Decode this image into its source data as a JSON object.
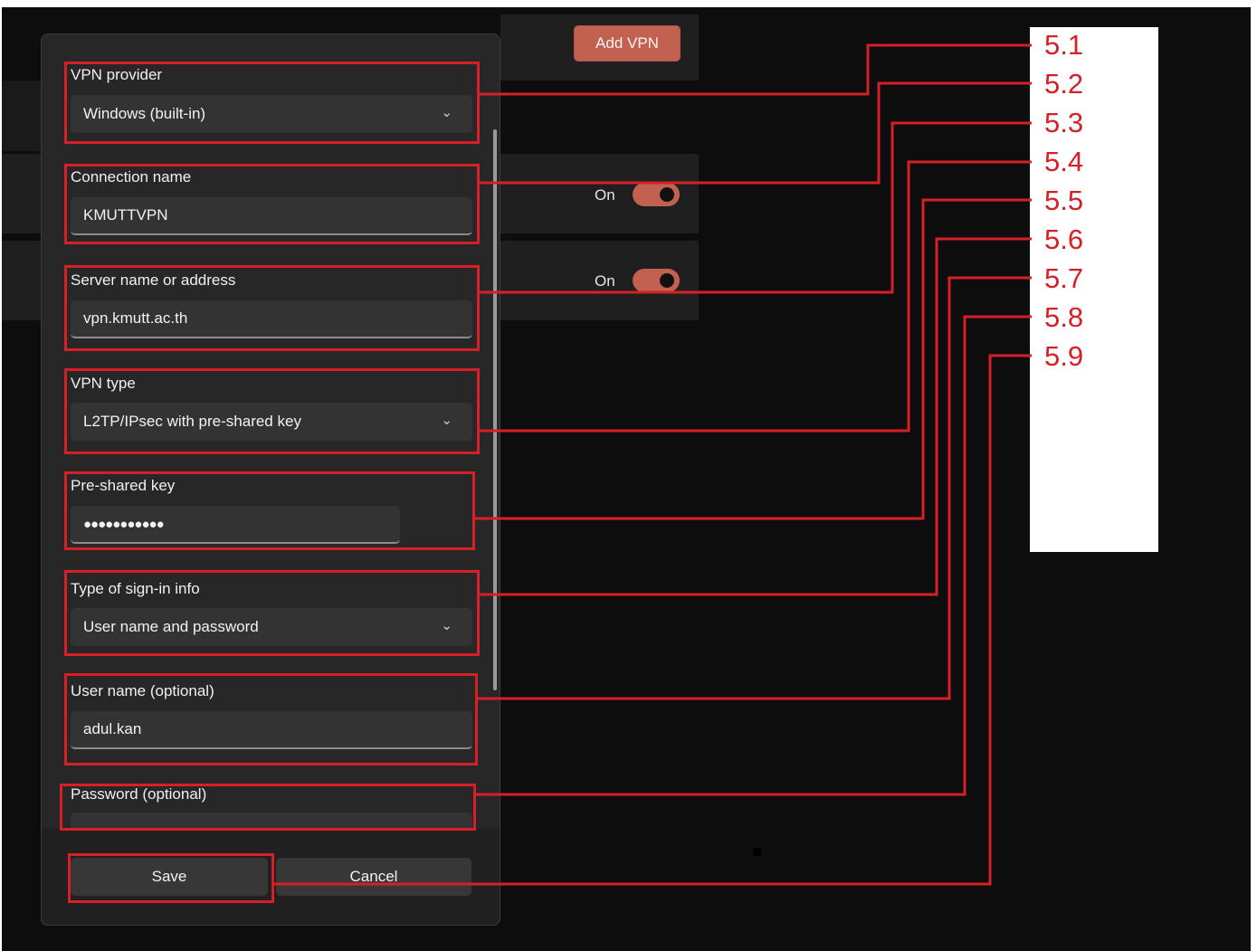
{
  "background": {
    "add_vpn_label": "Add VPN",
    "rows": [
      {
        "state_label": "On"
      },
      {
        "state_label": "On"
      }
    ]
  },
  "dialog": {
    "fields": [
      {
        "label": "VPN provider",
        "value": "Windows (built-in)",
        "kind": "dropdown"
      },
      {
        "label": "Connection name",
        "value": "KMUTTVPN",
        "kind": "text"
      },
      {
        "label": "Server name or address",
        "value": "vpn.kmutt.ac.th",
        "kind": "text"
      },
      {
        "label": "VPN type",
        "value": "L2TP/IPsec with pre-shared key",
        "kind": "dropdown"
      },
      {
        "label": "Pre-shared key",
        "value": "●●●●●●●●●●●",
        "kind": "password"
      },
      {
        "label": "Type of sign-in info",
        "value": "User name and password",
        "kind": "dropdown"
      },
      {
        "label": "User name (optional)",
        "value": "adul.kan",
        "kind": "text"
      },
      {
        "label": "Password (optional)",
        "kind": "password"
      }
    ],
    "save_label": "Save",
    "cancel_label": "Cancel"
  },
  "callouts": [
    "5.1",
    "5.2",
    "5.3",
    "5.4",
    "5.5",
    "5.6",
    "5.7",
    "5.8",
    "5.9"
  ],
  "colors": {
    "annotation_red": "#d62027",
    "accent": "#c2614f",
    "dialog_bg": "#272727",
    "screen_bg": "#0d0d0d"
  },
  "icons": {
    "dropdown": "chevron-down-icon",
    "toggle": "toggle-switch-icon"
  }
}
